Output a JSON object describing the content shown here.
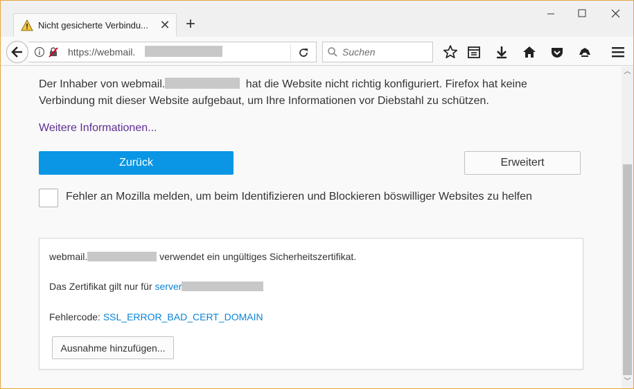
{
  "tab": {
    "title": "Nicht gesicherte Verbindu..."
  },
  "window_controls": {
    "minimize": "—",
    "maximize": "☐",
    "close": "✕"
  },
  "navbar": {
    "url": "https://webmail.",
    "search_placeholder": "Suchen"
  },
  "page": {
    "description_part1": "Der Inhaber von webmail.",
    "description_part2": " hat die Website nicht richtig konfiguriert. Firefox hat keine Verbindung mit dieser Website aufgebaut, um Ihre Informationen vor Diebstahl zu schützen.",
    "more_info_link": "Weitere Informationen...",
    "back_button": "Zurück",
    "advanced_button": "Erweitert",
    "report_label": "Fehler an Mozilla melden, um beim Identifizieren und Blockieren böswilliger Websites zu helfen"
  },
  "advanced": {
    "line1_prefix": "webmail.",
    "line1_suffix": "verwendet ein ungültiges Sicherheitszertifikat.",
    "line2_prefix": "Das Zertifikat gilt nur für ",
    "line2_link": "server",
    "line3_prefix": "Fehlercode: ",
    "line3_code": "SSL_ERROR_BAD_CERT_DOMAIN",
    "add_exception_button": "Ausnahme hinzufügen..."
  },
  "colors": {
    "primary_button": "#0a96e4",
    "visited_link": "#5e2d91",
    "link": "#0a84d6",
    "window_border": "#e8a33d"
  }
}
